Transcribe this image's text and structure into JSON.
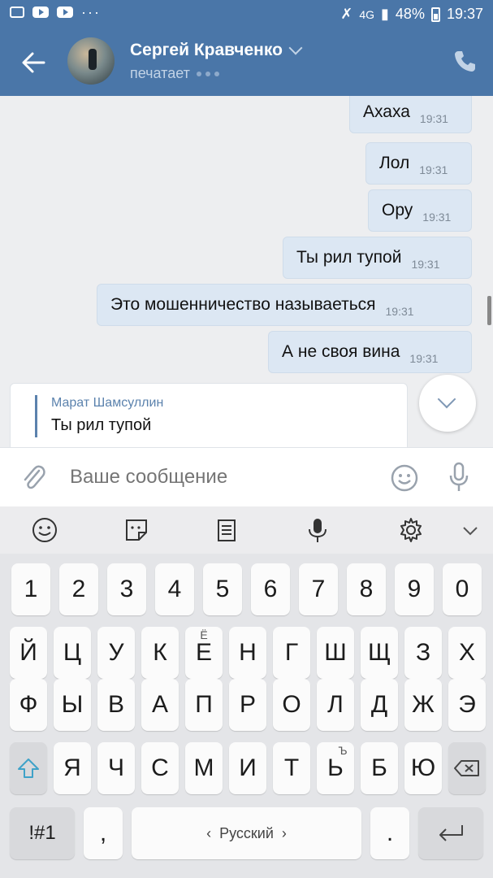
{
  "status_bar": {
    "network": "4G",
    "battery": "48%",
    "time": "19:37"
  },
  "header": {
    "contact_name": "Сергей Кравченко",
    "status": "печатает"
  },
  "messages": [
    {
      "text": "Ахаха",
      "time": "19:31"
    },
    {
      "text": "Лол",
      "time": "19:31"
    },
    {
      "text": "Ору",
      "time": "19:31"
    },
    {
      "text": "Ты рил тупой",
      "time": "19:31"
    },
    {
      "text": "Это мошенничество называеться",
      "time": "19:31"
    },
    {
      "text": "А не своя вина",
      "time": "19:31"
    }
  ],
  "incoming": {
    "quote_author": "Марат Шамсуллин",
    "quote_text": "Ты рил тупой"
  },
  "input": {
    "placeholder": "Ваше сообщение"
  },
  "keyboard": {
    "row_digits": [
      "1",
      "2",
      "3",
      "4",
      "5",
      "6",
      "7",
      "8",
      "9",
      "0"
    ],
    "row1": [
      "Й",
      "Ц",
      "У",
      "К",
      "Е",
      "Н",
      "Г",
      "Ш",
      "Щ",
      "З",
      "Х"
    ],
    "row2": [
      "Ф",
      "Ы",
      "В",
      "А",
      "П",
      "Р",
      "О",
      "Л",
      "Д",
      "Ж",
      "Э"
    ],
    "row3": [
      "Я",
      "Ч",
      "С",
      "М",
      "И",
      "Т",
      "Ь",
      "Б",
      "Ю"
    ],
    "alt_e": "Ё",
    "alt_soft": "Ъ",
    "symbols_key": "!#1",
    "comma_key": ",",
    "space_label": "Русский",
    "period_key": "."
  }
}
